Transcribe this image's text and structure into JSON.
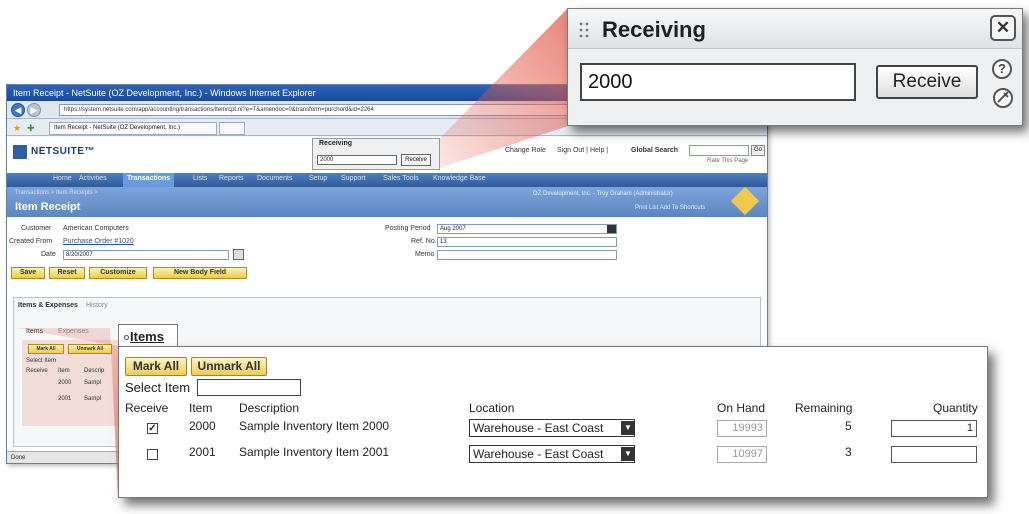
{
  "browser": {
    "window_title": "Item Receipt - NetSuite (OZ Development, Inc.) - Windows Internet Explorer",
    "url": "https://system.netsuite.com/app/accounting/transactions/itemrcpt.nl?e=T&amendoc=0&transform=purchord&id=2264",
    "tab_title": "Item Receipt - NetSuite (OZ Development, Inc.)",
    "status_text": "Done"
  },
  "netsuite": {
    "logo": "NETSUITE™",
    "change_role": "Change Role",
    "top_links": "Sign Out | Help |",
    "global_search_label": "Global Search",
    "go_label": "Go",
    "rate_page": "Rate This Page",
    "nav": [
      "Home",
      "Activities",
      "Transactions",
      "Lists",
      "Reports",
      "Documents",
      "Setup",
      "Support",
      "Sales Tools",
      "Knowledge Base"
    ],
    "active_nav": "Transactions",
    "breadcrumb": "Transactions > Item Receipts >",
    "page_title": "Item Receipt",
    "company": "OZ Development, Inc. - Troy Graham (Administrator)",
    "shortcut_links": "Print   List   Add To Shortcuts",
    "form": {
      "customer_label": "Customer",
      "customer_value": "American Computers",
      "created_from_label": "Created From",
      "created_from_value": "Purchase Order #1020",
      "date_label": "Date",
      "date_value": "8/20/2007",
      "posting_period_label": "Posting Period",
      "posting_period_value": "Aug 2007",
      "ref_no_label": "Ref. No.",
      "ref_no_value": "13",
      "memo_label": "Memo"
    },
    "buttons": {
      "save": "Save",
      "reset": "Reset",
      "customize": "Customize",
      "new_body_field": "New Body Field"
    },
    "subtabs": {
      "items_expenses": "Items & Expenses",
      "history": "History",
      "items": "Items",
      "expenses": "Expenses"
    },
    "mini_list": {
      "mark_all": "Mark All",
      "unmark_all": "Unmark All",
      "select_item": "Select Item",
      "receive": "Receive",
      "item": "Item",
      "description": "Descrip",
      "rows": [
        {
          "item": "2000",
          "desc": "Sampl"
        },
        {
          "item": "2001",
          "desc": "Sampl"
        }
      ]
    }
  },
  "receiving": {
    "title": "Receiving",
    "input_value": "2000",
    "button_label": "Receive",
    "help_symbol": "?",
    "close_symbol": "✕"
  },
  "items_zoom": {
    "tab_label": "Items",
    "mark_all": "Mark All",
    "unmark_all": "Unmark All",
    "select_item_label": "Select Item",
    "columns": {
      "receive": "Receive",
      "item": "Item",
      "description": "Description",
      "location": "Location",
      "on_hand": "On Hand",
      "remaining": "Remaining",
      "quantity": "Quantity"
    },
    "rows": [
      {
        "checked": true,
        "check_mark": "✓",
        "item": "2000",
        "description": "Sample Inventory Item 2000",
        "location": "Warehouse - East Coast",
        "on_hand": "19993",
        "remaining": "5",
        "quantity": "1"
      },
      {
        "checked": false,
        "check_mark": "",
        "item": "2001",
        "description": "Sample Inventory Item 2001",
        "location": "Warehouse - East Coast",
        "on_hand": "10997",
        "remaining": "3",
        "quantity": ""
      }
    ]
  },
  "colors": {
    "cone": "#e35d4e",
    "nav_blue": "#2f5b98",
    "button_gold": "#f1c94a"
  }
}
